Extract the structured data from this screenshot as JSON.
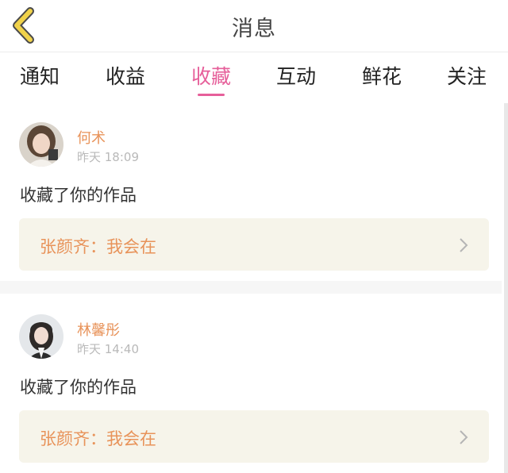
{
  "header": {
    "title": "消息",
    "back_icon": "chevron-left-icon",
    "back_color": "#f0d24a"
  },
  "tabs": [
    {
      "label": "通知",
      "active": false
    },
    {
      "label": "收益",
      "active": false
    },
    {
      "label": "收藏",
      "active": true
    },
    {
      "label": "互动",
      "active": false
    },
    {
      "label": "鲜花",
      "active": false
    },
    {
      "label": "关注",
      "active": false
    }
  ],
  "accent_color": "#e65f9a",
  "name_color": "#e8935a",
  "messages": [
    {
      "username": "何术",
      "time": "昨天 18:09",
      "action": "收藏了你的作品",
      "work": "张颜齐：我会在"
    },
    {
      "username": "林馨彤",
      "time": "昨天 14:40",
      "action": "收藏了你的作品",
      "work": "张颜齐：我会在"
    }
  ]
}
